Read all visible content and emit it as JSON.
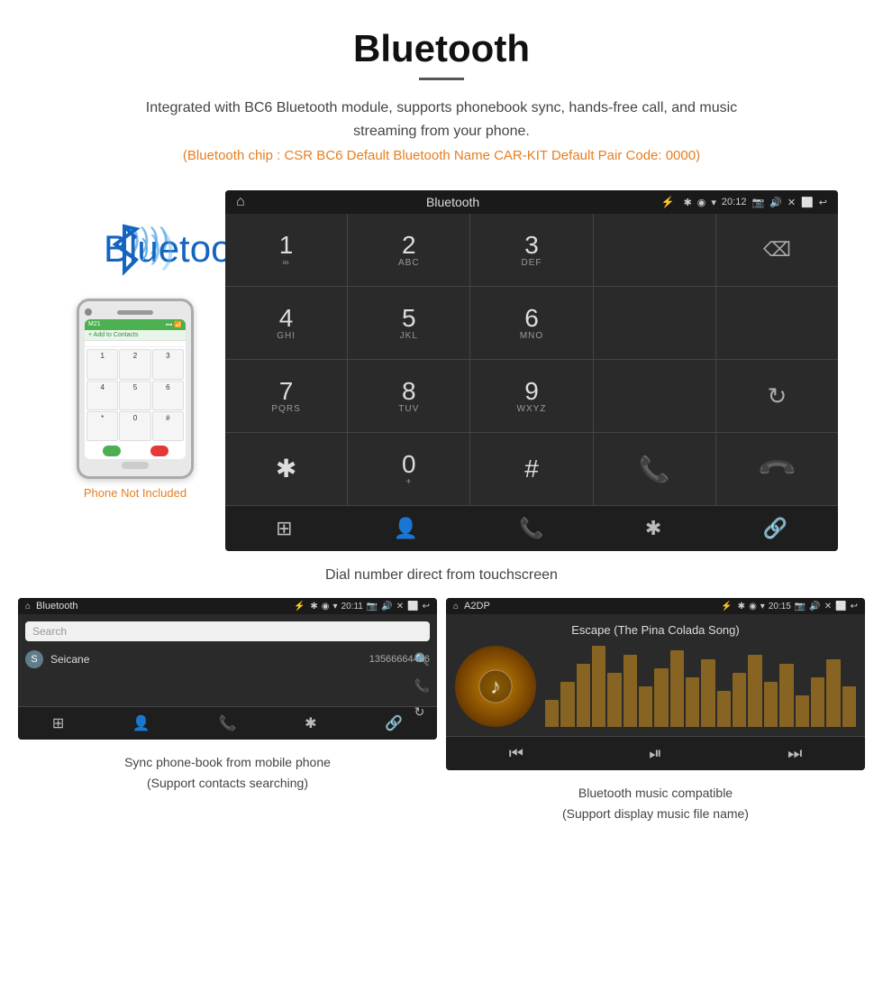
{
  "page": {
    "title": "Bluetooth",
    "description": "Integrated with BC6 Bluetooth module, supports phonebook sync, hands-free call, and music streaming from your phone.",
    "specs": "(Bluetooth chip : CSR BC6    Default Bluetooth Name CAR-KIT    Default Pair Code: 0000)",
    "main_caption": "Dial number direct from touchscreen",
    "phone_not_included": "Phone Not Included"
  },
  "main_screen": {
    "status_bar": {
      "home_icon": "⌂",
      "title": "Bluetooth",
      "usb_icon": "⚡",
      "time": "20:12",
      "camera_icon": "📷",
      "volume_icon": "🔊",
      "close_icon": "✕",
      "window_icon": "⬜",
      "back_icon": "↩"
    },
    "dialpad": {
      "keys": [
        {
          "digit": "1",
          "letters": "∞"
        },
        {
          "digit": "2",
          "letters": "ABC"
        },
        {
          "digit": "3",
          "letters": "DEF"
        },
        {
          "digit": "",
          "letters": ""
        },
        {
          "digit": "⌫",
          "letters": ""
        },
        {
          "digit": "4",
          "letters": "GHI"
        },
        {
          "digit": "5",
          "letters": "JKL"
        },
        {
          "digit": "6",
          "letters": "MNO"
        },
        {
          "digit": "",
          "letters": ""
        },
        {
          "digit": "",
          "letters": ""
        },
        {
          "digit": "7",
          "letters": "PQRS"
        },
        {
          "digit": "8",
          "letters": "TUV"
        },
        {
          "digit": "9",
          "letters": "WXYZ"
        },
        {
          "digit": "",
          "letters": ""
        },
        {
          "digit": "↻",
          "letters": ""
        },
        {
          "digit": "*",
          "letters": ""
        },
        {
          "digit": "0",
          "letters": "+"
        },
        {
          "digit": "#",
          "letters": ""
        },
        {
          "digit": "📞",
          "letters": "green"
        },
        {
          "digit": "📞",
          "letters": "red"
        }
      ],
      "bottom_icons": [
        "⊞",
        "👤",
        "📞",
        "✱",
        "🔗"
      ]
    }
  },
  "phonebook_screen": {
    "status": {
      "home": "⌂",
      "title": "Bluetooth",
      "time": "20:11"
    },
    "search_placeholder": "Search",
    "contacts": [
      {
        "letter": "S",
        "name": "Seicane",
        "number": "13566664466"
      }
    ],
    "right_icons": [
      "🔍",
      "📞",
      "↻"
    ],
    "bottom_icons": [
      "⊞",
      "👤",
      "📞",
      "✱",
      "🔗"
    ]
  },
  "music_screen": {
    "status": {
      "home": "⌂",
      "title": "A2DP",
      "time": "20:15"
    },
    "song_title": "Escape (The Pina Colada Song)",
    "visualizer_heights": [
      30,
      50,
      70,
      90,
      60,
      80,
      45,
      65,
      85,
      55,
      75,
      40,
      60,
      80,
      50,
      70,
      35,
      55,
      75,
      45
    ],
    "controls": [
      "⏮",
      "⏯",
      "⏭"
    ]
  },
  "bottom_captions": {
    "left": "Sync phone-book from mobile phone\n(Support contacts searching)",
    "right": "Bluetooth music compatible\n(Support display music file name)"
  },
  "colors": {
    "orange": "#e67e22",
    "green": "#4caf50",
    "red": "#e53935",
    "blue": "#1565c0",
    "dark_bg": "#2a2a2a",
    "darker_bg": "#1a1a1a"
  }
}
